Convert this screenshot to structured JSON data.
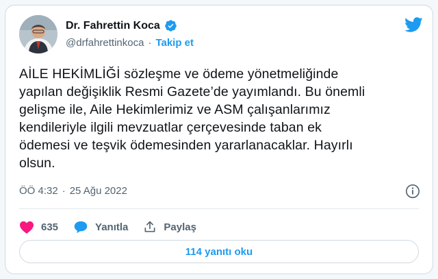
{
  "author": {
    "name": "Dr. Fahrettin Koca",
    "handle": "@drfahrettinkoca",
    "separator": "·",
    "follow_label": "Takip et"
  },
  "tweet": {
    "lines": [
      "AİLE HEKİMLİĞİ sözleşme ve ödeme yönetmeliğinde",
      "yapılan değişiklik Resmi Gazete’de yayımlandı. Bu önemli",
      "gelişme ile, Aile Hekimlerimiz ve ASM çalışanlarımız",
      "kendileriyle ilgili mevzuatlar çerçevesinde taban ek",
      "ödemesi ve teşvik ödemesinden yararlanacaklar. Hayırlı",
      "olsun."
    ],
    "time": "ÖÖ 4:32",
    "separator": "·",
    "date": "25 Ağu 2022"
  },
  "actions": {
    "likes_count": "635",
    "reply_label": "Yanıtla",
    "share_label": "Paylaş"
  },
  "replies_button": "114 yanıtı oku",
  "icons": [
    "avatar",
    "verified-badge-icon",
    "twitter-bird-icon",
    "info-icon",
    "heart-icon",
    "reply-bubble-icon",
    "share-icon"
  ],
  "colors": {
    "accent": "#1d9bf0",
    "heart": "#f91880",
    "text": "#0f1419",
    "muted": "#536471"
  }
}
